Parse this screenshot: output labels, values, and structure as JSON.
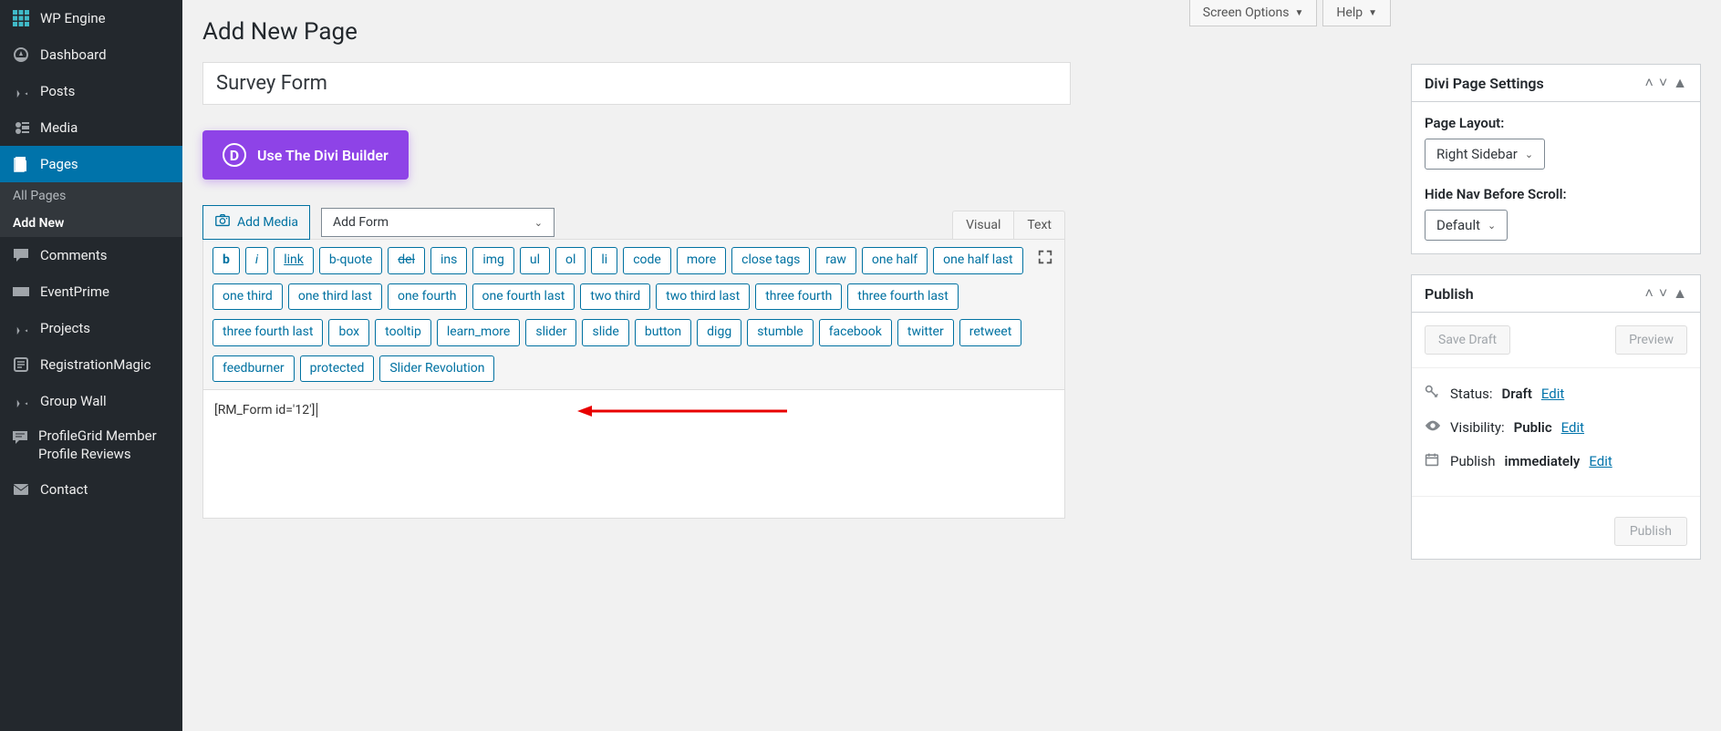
{
  "topbar": {
    "screen_options": "Screen Options",
    "help": "Help"
  },
  "sidebar": {
    "items": [
      {
        "label": "WP Engine"
      },
      {
        "label": "Dashboard"
      },
      {
        "label": "Posts"
      },
      {
        "label": "Media"
      },
      {
        "label": "Pages"
      },
      {
        "label": "Comments"
      },
      {
        "label": "EventPrime"
      },
      {
        "label": "Projects"
      },
      {
        "label": "RegistrationMagic"
      },
      {
        "label": "Group Wall"
      },
      {
        "label": "ProfileGrid Member Profile Reviews"
      },
      {
        "label": "Contact"
      }
    ],
    "subitems": {
      "all_pages": "All Pages",
      "add_new": "Add New"
    }
  },
  "main": {
    "heading": "Add New Page",
    "title_value": "Survey Form",
    "divi_button": "Use The Divi Builder",
    "add_media": "Add Media",
    "add_form": "Add Form",
    "tabs": {
      "visual": "Visual",
      "text": "Text"
    },
    "qt_buttons": [
      "b",
      "i",
      "link",
      "b-quote",
      "del",
      "ins",
      "img",
      "ul",
      "ol",
      "li",
      "code",
      "more",
      "close tags",
      "raw",
      "one half",
      "one half last",
      "one third",
      "one third last",
      "one fourth",
      "one fourth last",
      "two third",
      "two third last",
      "three fourth",
      "three fourth last",
      "three fourth last",
      "box",
      "tooltip",
      "learn_more",
      "slider",
      "slide",
      "button",
      "digg",
      "stumble",
      "facebook",
      "twitter",
      "retweet",
      "feedburner",
      "protected",
      "Slider Revolution"
    ],
    "content": "[RM_Form id='12']"
  },
  "panels": {
    "divi": {
      "title": "Divi Page Settings",
      "page_layout_label": "Page Layout:",
      "page_layout_value": "Right Sidebar",
      "hide_nav_label": "Hide Nav Before Scroll:",
      "hide_nav_value": "Default"
    },
    "publish": {
      "title": "Publish",
      "save_draft": "Save Draft",
      "preview": "Preview",
      "status_label": "Status:",
      "status_value": "Draft",
      "visibility_label": "Visibility:",
      "visibility_value": "Public",
      "publish_label": "Publish",
      "publish_value": "immediately",
      "edit": "Edit",
      "publish_btn": "Publish"
    }
  }
}
